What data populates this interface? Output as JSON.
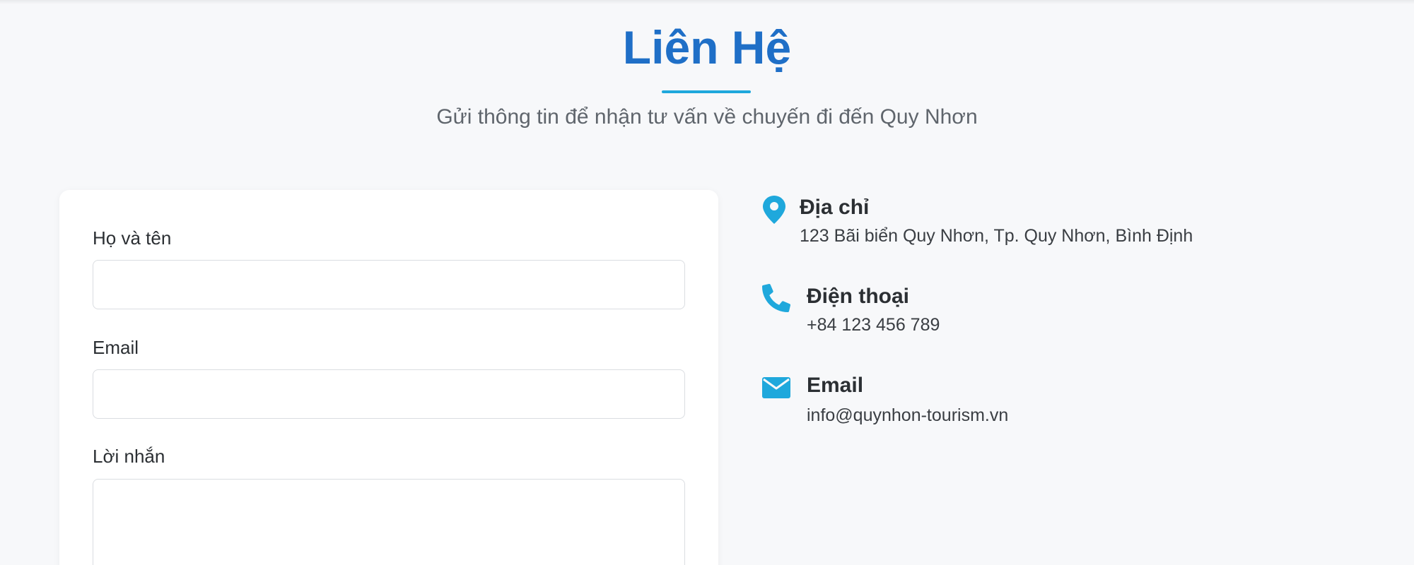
{
  "header": {
    "title": "Liên Hệ",
    "subtitle": "Gửi thông tin để nhận tư vấn về chuyến đi đến Quy Nhơn"
  },
  "form": {
    "name_label": "Họ và tên",
    "name_value": "",
    "email_label": "Email",
    "email_value": "",
    "message_label": "Lời nhắn",
    "message_value": ""
  },
  "contact": {
    "address": {
      "icon": "map-pin-icon",
      "title": "Địa chỉ",
      "value": "123 Bãi biển Quy Nhơn, Tp. Quy Nhơn, Bình Định"
    },
    "phone": {
      "icon": "phone-icon",
      "title": "Điện thoại",
      "value": "+84 123 456 789"
    },
    "email": {
      "icon": "envelope-icon",
      "title": "Email",
      "value": "info@quynhon-tourism.vn"
    }
  },
  "colors": {
    "title": "#1f6fc7",
    "accent": "#1fa8dc",
    "background": "#f7f8fa",
    "text": "#2b2f33"
  }
}
